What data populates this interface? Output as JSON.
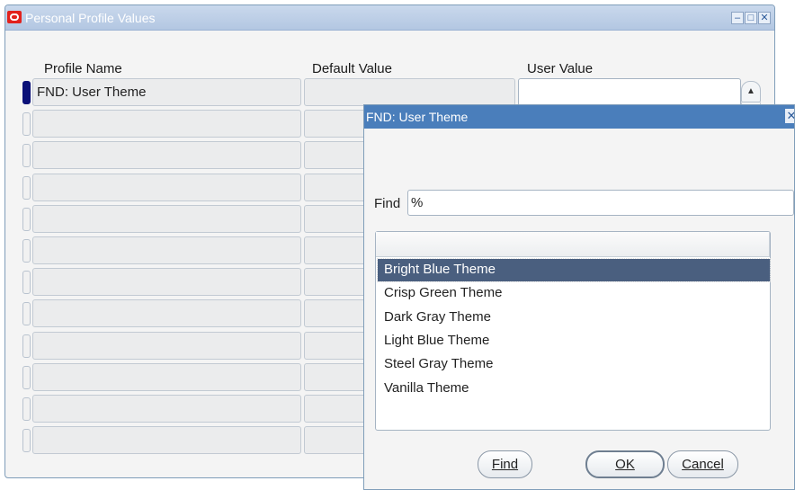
{
  "main_window": {
    "title": "Personal Profile Values",
    "controls": {
      "minimize_icon": "minimize-icon",
      "maximize_icon": "maximize-icon",
      "close_icon": "close-icon"
    }
  },
  "table": {
    "columns": {
      "profile_name": "Profile Name",
      "default_value": "Default Value",
      "user_value": "User Value"
    },
    "rows": [
      {
        "profile_name": "FND: User Theme",
        "default_value": "",
        "user_value": ""
      },
      {
        "profile_name": "",
        "default_value": "",
        "user_value": ""
      },
      {
        "profile_name": "",
        "default_value": "",
        "user_value": ""
      },
      {
        "profile_name": "",
        "default_value": "",
        "user_value": ""
      },
      {
        "profile_name": "",
        "default_value": "",
        "user_value": ""
      },
      {
        "profile_name": "",
        "default_value": "",
        "user_value": ""
      },
      {
        "profile_name": "",
        "default_value": "",
        "user_value": ""
      },
      {
        "profile_name": "",
        "default_value": "",
        "user_value": ""
      },
      {
        "profile_name": "",
        "default_value": "",
        "user_value": ""
      },
      {
        "profile_name": "",
        "default_value": "",
        "user_value": ""
      },
      {
        "profile_name": "",
        "default_value": "",
        "user_value": ""
      },
      {
        "profile_name": "",
        "default_value": "",
        "user_value": ""
      }
    ]
  },
  "lov": {
    "title": "FND: User Theme",
    "find_label": "Find",
    "find_value": "%",
    "items": [
      "Bright Blue Theme",
      "Crisp Green Theme",
      "Dark Gray Theme",
      "Light Blue Theme",
      "Steel Gray Theme",
      "Vanilla Theme"
    ],
    "selected_index": 0,
    "buttons": {
      "find": "Find",
      "ok": "OK",
      "cancel": "Cancel"
    }
  },
  "colors": {
    "title_bar": "#b3c7e2",
    "dialog_title_bar": "#4a7ebb",
    "selection": "#4a5f7f",
    "active_row_indicator": "#0b1178"
  }
}
